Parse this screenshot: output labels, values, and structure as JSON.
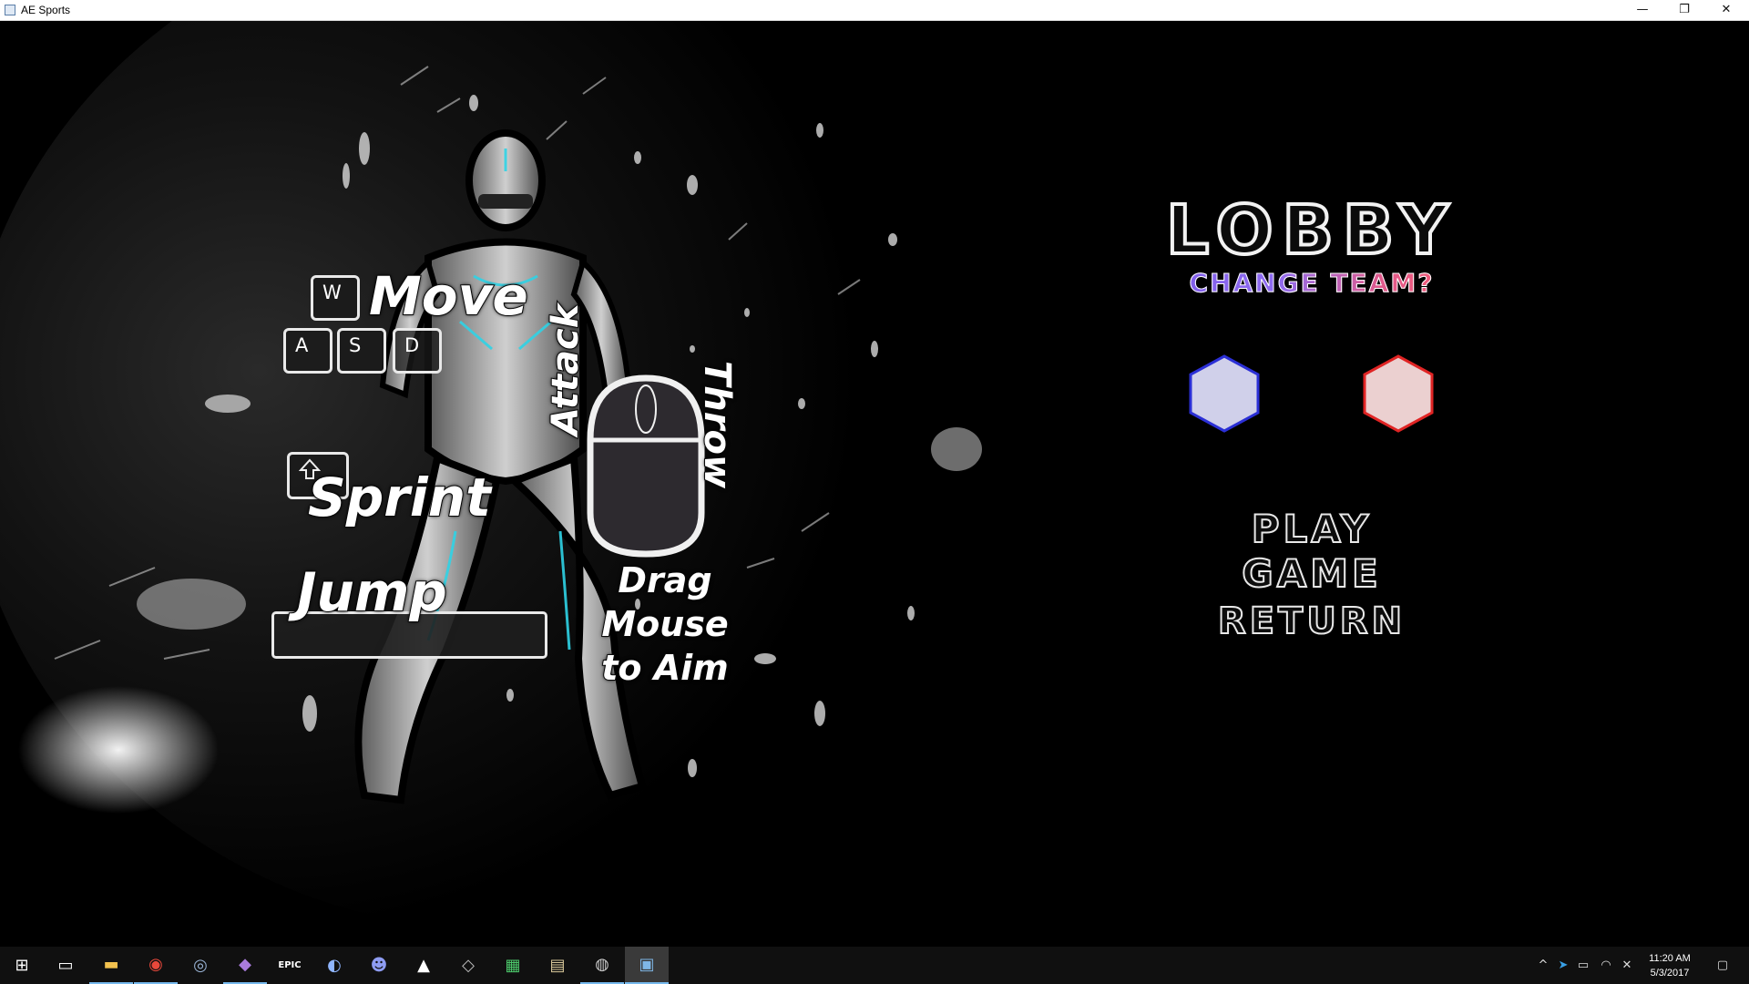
{
  "window": {
    "title": "AE Sports",
    "minimize": "—",
    "restore": "❐",
    "close": "✕"
  },
  "controls": {
    "key_w": "W",
    "key_a": "A",
    "key_s": "S",
    "key_d": "D",
    "move": "Move",
    "sprint": "Sprint",
    "jump": "Jump",
    "attack": "Attack",
    "throw": "Throw",
    "drag_line1": "Drag Mouse",
    "drag_line2": "to Aim"
  },
  "menu": {
    "title": "LOBBY",
    "change_team": "CHANGE TEAM?",
    "play_game": "PLAY GAME",
    "return": "RETURN",
    "team_blue_color": "#d0d0ea",
    "team_red_color": "#ebd0d0"
  },
  "taskbar": {
    "apps": [
      {
        "icon": "windows-start-icon",
        "glyph": "⊞"
      },
      {
        "icon": "task-view-icon",
        "glyph": "▭"
      },
      {
        "icon": "file-explorer-icon",
        "glyph": "▬"
      },
      {
        "icon": "chrome-icon",
        "glyph": "◉"
      },
      {
        "icon": "steam-icon",
        "glyph": "◎"
      },
      {
        "icon": "visual-studio-icon",
        "glyph": "◆"
      },
      {
        "icon": "epic-games-icon",
        "glyph": "EPIC"
      },
      {
        "icon": "app-icon",
        "glyph": "◐"
      },
      {
        "icon": "discord-icon",
        "glyph": "☻"
      },
      {
        "icon": "unity-icon",
        "glyph": "▲"
      },
      {
        "icon": "app-icon",
        "glyph": "◇"
      },
      {
        "icon": "grid-app-icon",
        "glyph": "▦"
      },
      {
        "icon": "app-icon",
        "glyph": "▤"
      },
      {
        "icon": "obs-icon",
        "glyph": "◍"
      },
      {
        "icon": "ae-sports-icon",
        "glyph": "▣"
      }
    ],
    "time": "11:20 AM",
    "date": "5/3/2017"
  }
}
